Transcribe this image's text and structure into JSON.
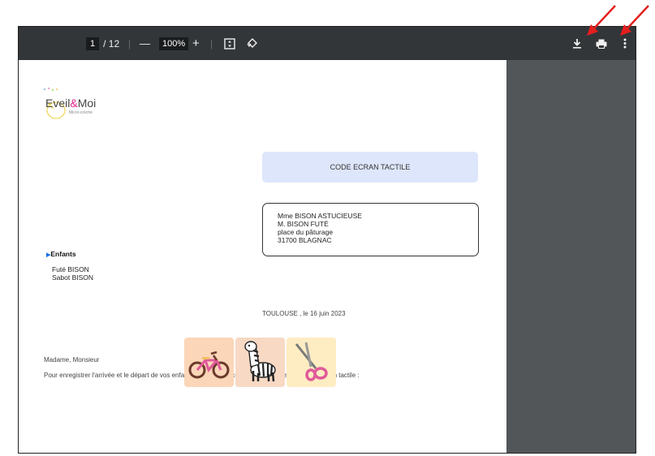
{
  "toolbar": {
    "current_page": "1",
    "page_total": "/ 12",
    "zoom_out": "—",
    "zoom_level": "100%",
    "zoom_in": "+"
  },
  "letter": {
    "logo_name_part1": "Eveil",
    "logo_name_amp": "&",
    "logo_name_part2": "Moi",
    "logo_subtitle": "Micro-crèche",
    "code_title": "CODE ECRAN TACTILE",
    "address": [
      "Mme BISON ASTUCIEUSE",
      "M. BISON FUTÉ",
      "place du pâturage",
      "31700 BLAGNAC"
    ],
    "children_heading": "Enfants",
    "children": [
      "Futé BISON",
      "Sabot BISON"
    ],
    "date_line": "TOULOUSE , le 16 juin 2023",
    "greeting": "Madame, Monsieur",
    "body": "Pour enregistrer l'arrivée et le départ de vos enfants vous devrez composer le code suivant sur l'écran tactile :"
  },
  "code_images": [
    "bicycle",
    "zebra",
    "scissors"
  ],
  "colors": {
    "toolbar_bg": "#323639",
    "side_panel": "#525659",
    "code_box": "#dde6fa",
    "annotation_arrow": "#e41e1e"
  }
}
